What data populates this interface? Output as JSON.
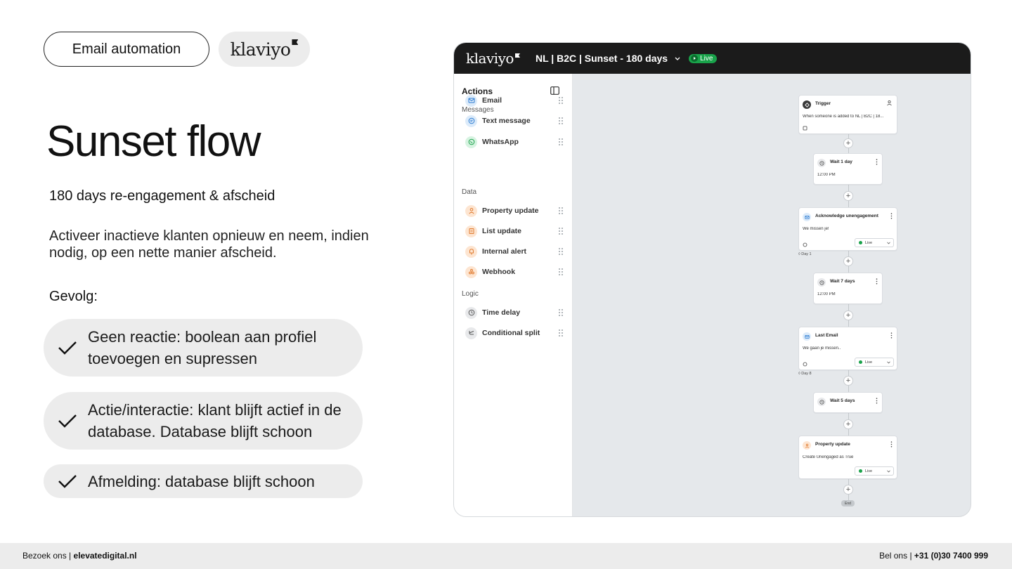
{
  "slide": {
    "tag": "Email automation",
    "logo_text": "klaviyo",
    "title": "Sunset flow",
    "subtitle": "180 days re-engagement & afscheid",
    "description": "Activeer inactieve klanten opnieuw en neem, indien nodig, op een nette manier afscheid.",
    "result_heading": "Gevolg:",
    "bullets": [
      "Geen reactie: boolean aan profiel toevoegen en supressen",
      "Actie/interactie: klant blijft actief in de database. Database blijft schoon",
      "Afmelding: database blijft schoon"
    ]
  },
  "footer": {
    "visit_prefix": "Bezoek ons |",
    "website": "elevatedigital.nl",
    "call_prefix": "Bel ons |",
    "phone": "+31 (0)30 7400 999"
  },
  "app": {
    "logo_text": "klaviyo",
    "flow_name": "NL | B2C | Sunset - 180 days",
    "status": "Live",
    "sidebar": {
      "title": "Actions",
      "sections": [
        {
          "label": "Messages",
          "items": [
            {
              "label": "Email",
              "icon": "mail-icon"
            },
            {
              "label": "Text message",
              "icon": "message-icon"
            },
            {
              "label": "WhatsApp",
              "icon": "whatsapp-icon"
            }
          ]
        },
        {
          "label": "Data",
          "items": [
            {
              "label": "Property update",
              "icon": "person-icon"
            },
            {
              "label": "List update",
              "icon": "list-icon"
            },
            {
              "label": "Internal alert",
              "icon": "bell-icon"
            },
            {
              "label": "Webhook",
              "icon": "webhook-icon"
            }
          ]
        },
        {
          "label": "Logic",
          "items": [
            {
              "label": "Time delay",
              "icon": "clock-icon"
            },
            {
              "label": "Conditional split",
              "icon": "split-icon"
            }
          ]
        }
      ]
    },
    "flow": {
      "trigger": {
        "title": "Trigger",
        "text": "When someone is added to NL | B2C | 18..."
      },
      "wait1": {
        "title": "Wait 1 day",
        "text": "12:00 PM"
      },
      "email1": {
        "title": "Acknowledge unengagement",
        "text": "We missen je!",
        "status": "Live",
        "day": "Day 1"
      },
      "wait2": {
        "title": "Wait 7 days",
        "text": "12:00 PM"
      },
      "email2": {
        "title": "Last Email",
        "text": "We gaan je missen..",
        "status": "Live",
        "day": "Day 8"
      },
      "wait3": {
        "title": "Wait 5 days"
      },
      "property": {
        "title": "Property update",
        "text": "Create Unengaged as True",
        "status": "Live"
      },
      "end": "End"
    }
  },
  "colors": {
    "pill_bg": "#ececec",
    "app_header": "#1b1b1b",
    "canvas_bg": "#e5e8eb",
    "live_green": "#19a24a",
    "email_icon_bg": "#dcebfa",
    "data_icon_bg": "#fde5d1",
    "logic_icon_bg": "#e8e9eb"
  }
}
